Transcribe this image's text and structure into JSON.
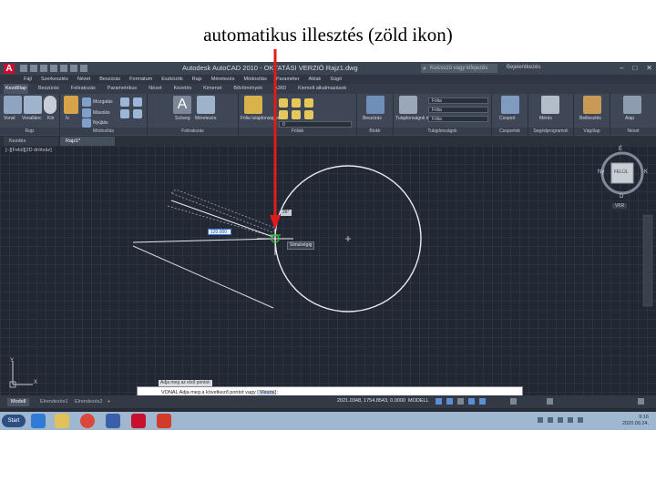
{
  "caption": "automatikus illesztés (zöld ikon)",
  "window": {
    "title": "Autodesk AutoCAD 2010 - OKTATÁSI VERZIÓ    Rajz1.dwg",
    "search_placeholder": "Kulcsszó vagy kifejezés",
    "signin": "Bejelentkezés",
    "buttons": [
      "–",
      "□",
      "✕"
    ]
  },
  "menubar": [
    "Fájl",
    "Szerkesztés",
    "Nézet",
    "Beszúrás",
    "Formátum",
    "Eszközök",
    "Rajz",
    "Méretezés",
    "Módosítás",
    "Paraméter",
    "Ablak",
    "Súgó"
  ],
  "ribbon_tabs": [
    "Kezdőlap",
    "Beszúrás",
    "Feliratozás",
    "Parametrikus",
    "Nézet",
    "Kezelés",
    "Kimenet",
    "Bővítmények",
    "A360",
    "Kiemelt alkalmazások"
  ],
  "ribbon": {
    "groups": [
      "Rajz",
      "Módosítás",
      "Feliratozás",
      "Fóliák",
      "Blokk",
      "Tulajdonságok",
      "Csoportok",
      "Segédprogramok",
      "Vágólap",
      "Nézet"
    ],
    "captions": {
      "line": "Vonal",
      "polyline": "Vonallánc",
      "circle": "Kör",
      "arc": "Ív",
      "move": "Mozgatás",
      "copy": "Másolás",
      "stretch": "Nyújtás",
      "text": "Szöveg",
      "dimension": "Méretezés",
      "layer_props": "Fólia tulajdonságok",
      "insert": "Beszúrás",
      "match_props": "Tulajdonságok másolása",
      "group": "Csoport",
      "measure": "Mérés",
      "paste": "Beillesztés",
      "base": "Alap"
    },
    "layer_value": "Fólia",
    "layer_combo": "0",
    "color_combo": "Fólia",
    "linetype_combo": "Fólia"
  },
  "file_tabs": [
    "Kezdés",
    "Rajz1*"
  ],
  "viewport_label": "[–][Felül][2D drótváz]",
  "drawing": {
    "snap_label": "Simulvégig",
    "input_value": "120.000",
    "angle_label": "26°"
  },
  "viewcube": {
    "top": "É",
    "bottom": "D",
    "left": "Ny",
    "right": "K",
    "face": "FELÜL",
    "wcs": "VKR"
  },
  "ucs": {
    "x": "X",
    "y": "Y"
  },
  "command": {
    "history": "Adja meg az első pontot:",
    "prefix": "VONAL Adja meg a következő pontot vagy [",
    "option": "Vissza",
    "suffix": "]:"
  },
  "status": {
    "coords": "2021.0348, 1754.8543, 0.0000",
    "model": "MODELL"
  },
  "layout_tabs": [
    "Modell",
    "Elrendezés1",
    "Elrendezés2",
    "+"
  ],
  "taskbar": {
    "start": "Start",
    "time": "9:16",
    "date": "2020.09.24."
  },
  "colors": {
    "accent_red": "#e01b1b",
    "snap_green": "#3fbf3f",
    "canvas_bg": "#222833"
  }
}
